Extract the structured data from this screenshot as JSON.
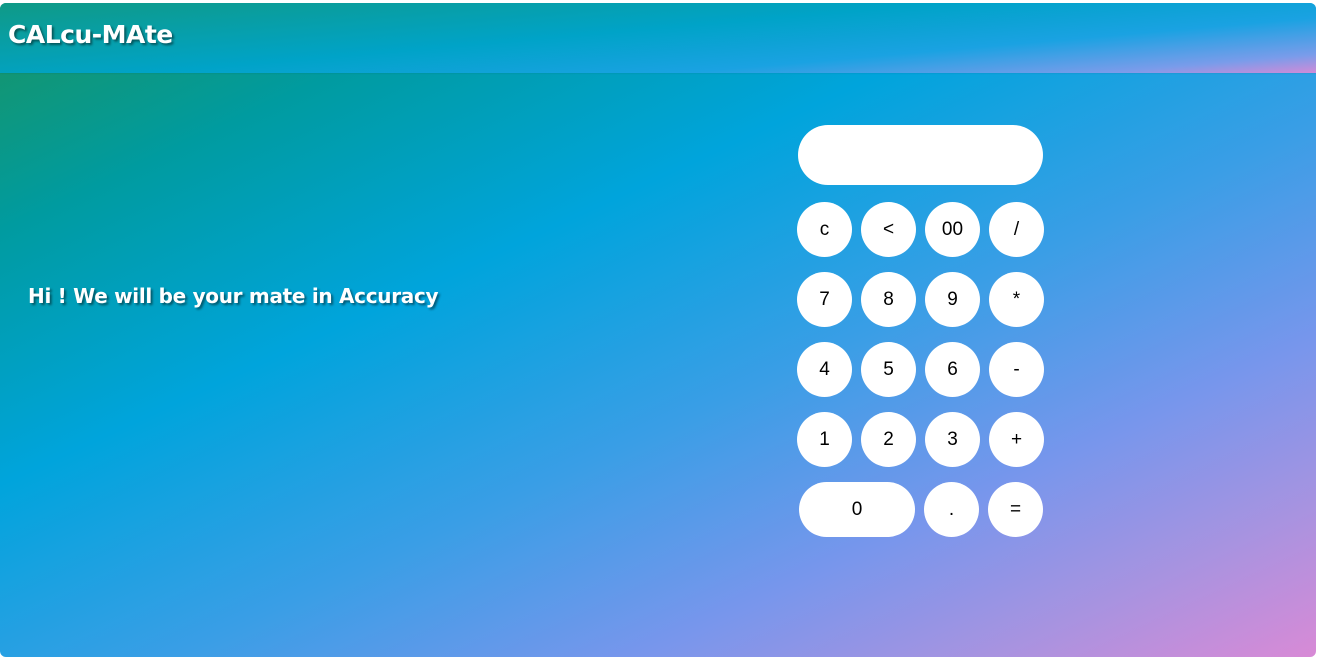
{
  "header": {
    "title": "CALcu-MAte"
  },
  "main": {
    "tagline": "Hi ! We will be your mate in Accuracy"
  },
  "calculator": {
    "display_value": "",
    "keys": {
      "clear": "c",
      "backspace": "<",
      "double_zero": "00",
      "divide": "/",
      "seven": "7",
      "eight": "8",
      "nine": "9",
      "multiply": "*",
      "four": "4",
      "five": "5",
      "six": "6",
      "subtract": "-",
      "one": "1",
      "two": "2",
      "three": "3",
      "add": "+",
      "zero": "0",
      "decimal": ".",
      "equals": "="
    }
  }
}
